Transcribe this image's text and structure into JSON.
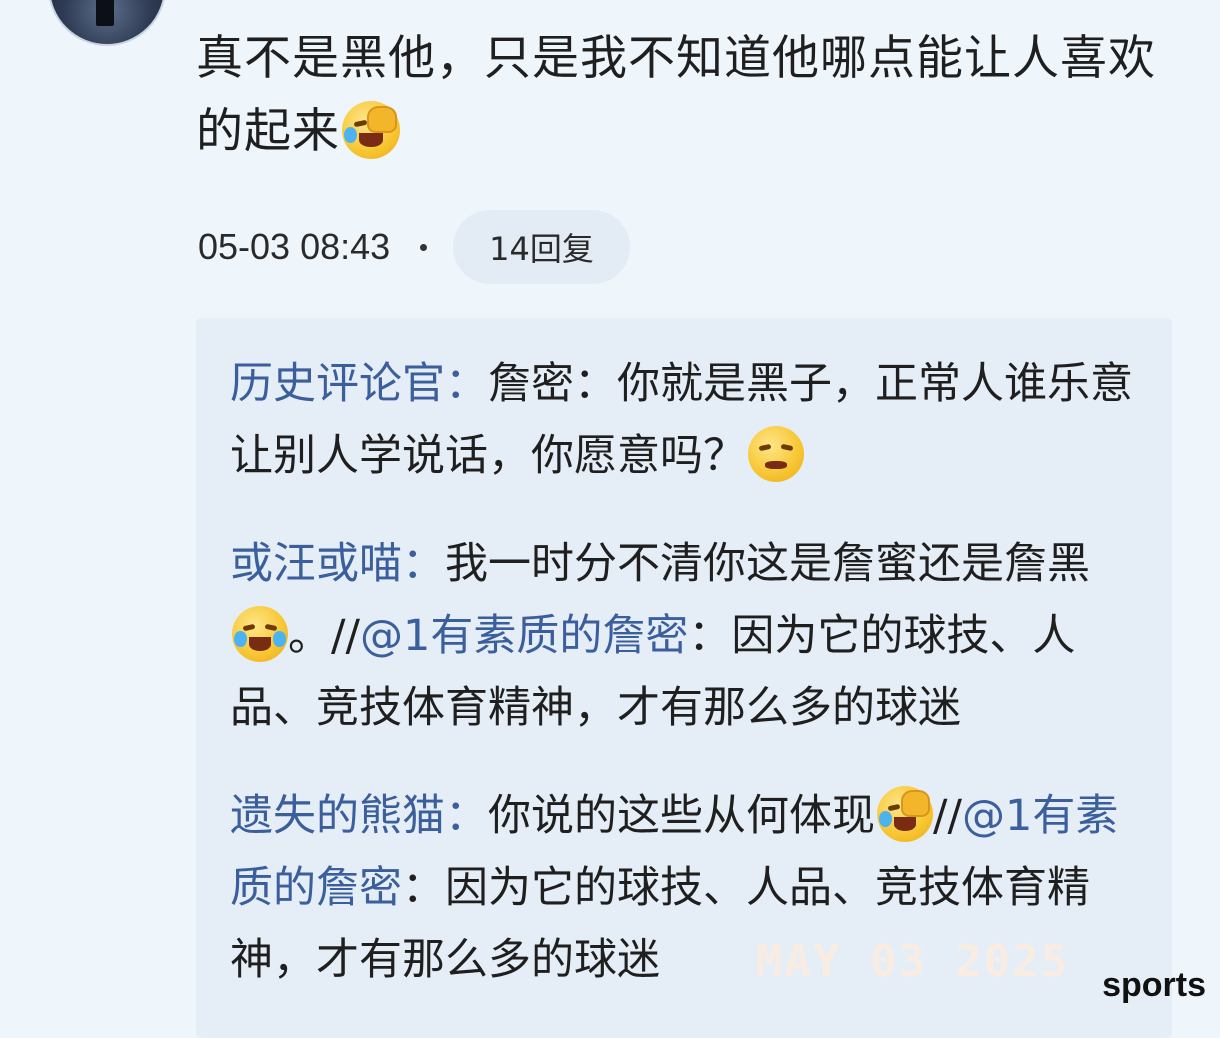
{
  "post": {
    "text": "真不是黑他，只是我不知道他哪点能让人喜欢的起来",
    "emoji": "crying-face-icon",
    "timestamp": "05-03 08:43",
    "reply_count_label": "14回复"
  },
  "replies": [
    {
      "author": "历史评论官",
      "separator": "：",
      "text": "詹密：你就是黑子，正常人谁乐意让别人学说话，你愿意吗？",
      "emoji": "dizzy-face-icon"
    },
    {
      "author": "或汪或喵",
      "separator": "：",
      "text_before": "我一时分不清你这是詹蜜还是詹黑",
      "emoji": "tears-of-joy-icon",
      "text_middle": "。//",
      "mention": "@1有素质的詹密",
      "mention_separator": "：",
      "text_after": "因为它的球技、人品、竞技体育精神，才有那么多的球迷"
    },
    {
      "author": "遗失的熊猫",
      "separator": "：",
      "text_before": "你说的这些从何体现",
      "emoji": "crying-face-icon",
      "text_middle": "//",
      "mention": "@1有素质的詹密",
      "mention_separator": "：",
      "text_after": "因为它的球技、人品、竞技体育精神，才有那么多的球迷"
    }
  ],
  "watermark": "MAY 03 2025",
  "brand": "sports"
}
